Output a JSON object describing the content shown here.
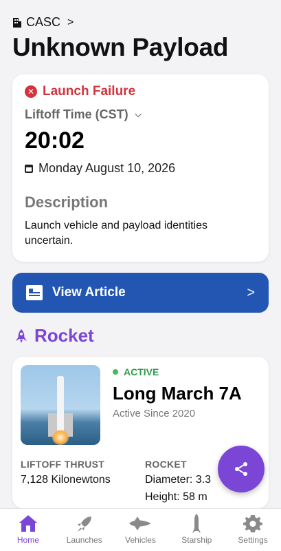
{
  "header": {
    "breadcrumb": "CASC",
    "title": "Unknown Payload"
  },
  "launch": {
    "status": "Launch Failure",
    "liftoff_label": "Liftoff Time (CST)",
    "liftoff_time": "20:02",
    "date": "Monday August 10, 2026",
    "description_label": "Description",
    "description": "Launch vehicle and payload identities uncertain."
  },
  "article": {
    "label": "View Article"
  },
  "rocket_section": {
    "heading": "Rocket",
    "status": "ACTIVE",
    "name": "Long March 7A",
    "active_since": "Active Since 2020",
    "stats": {
      "thrust_label": "LIFTOFF THRUST",
      "thrust_value": "7,128 Kilonewtons",
      "rocket_label": "ROCKET",
      "diameter": "Diameter: 3.3",
      "height": "Height: 58 m"
    }
  },
  "nav": {
    "items": [
      {
        "label": "Home",
        "icon": "home-icon"
      },
      {
        "label": "Launches",
        "icon": "rocket-icon"
      },
      {
        "label": "Vehicles",
        "icon": "shuttle-icon"
      },
      {
        "label": "Starship",
        "icon": "starship-icon"
      },
      {
        "label": "Settings",
        "icon": "gear-icon"
      }
    ],
    "active": "Home"
  },
  "colors": {
    "accent": "#7b46d6",
    "failure": "#d3333c",
    "article_button": "#2256b2",
    "active_status": "#2e9b4d"
  }
}
